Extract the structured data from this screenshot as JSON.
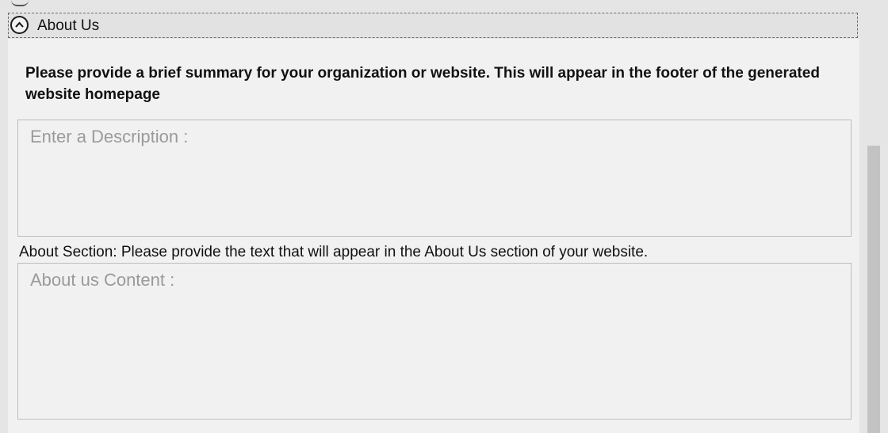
{
  "section": {
    "title": "About Us"
  },
  "summary": {
    "label": "Please provide a brief summary for your organization or website. This will appear in the footer of the generated website homepage",
    "placeholder": "Enter a Description :"
  },
  "about": {
    "label": "About Section: Please provide the text that will appear in the About Us section of your website.",
    "placeholder": "About us Content :"
  },
  "icons": {
    "collapse": "chevron-up-icon"
  }
}
